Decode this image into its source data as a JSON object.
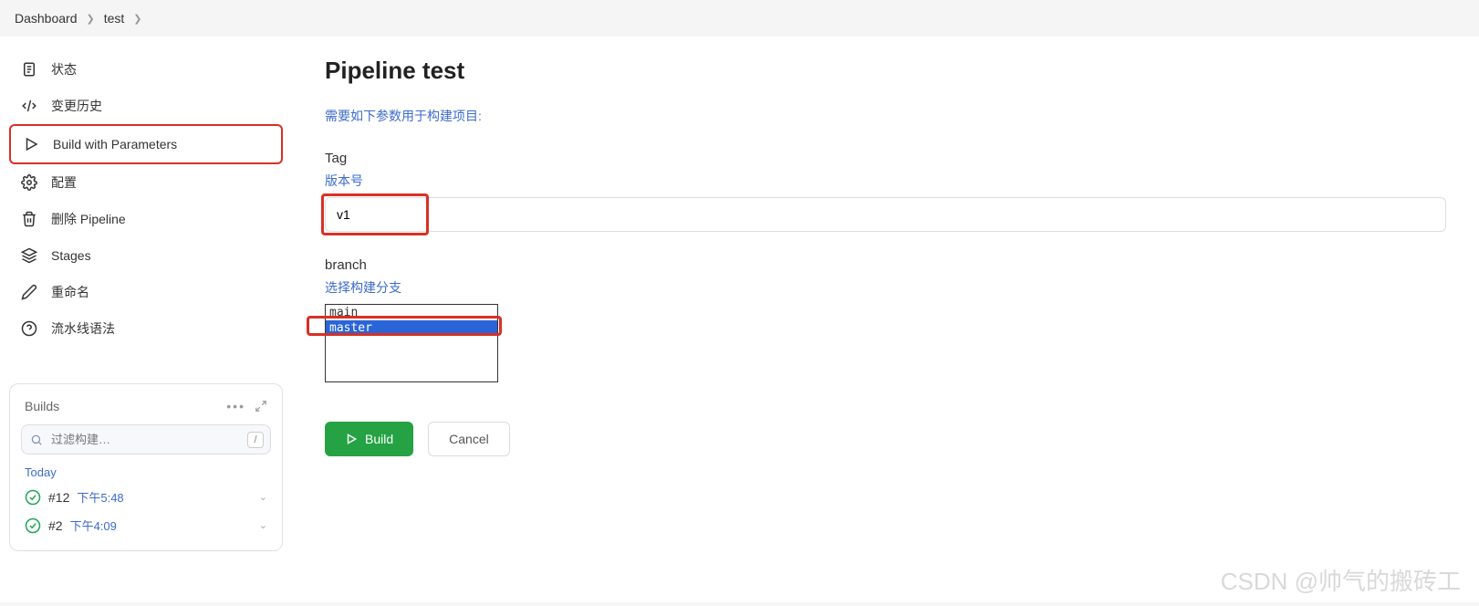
{
  "breadcrumb": {
    "dashboard": "Dashboard",
    "project": "test"
  },
  "sidebar": {
    "items": [
      {
        "label": "状态"
      },
      {
        "label": "变更历史"
      },
      {
        "label": "Build with Parameters"
      },
      {
        "label": "配置"
      },
      {
        "label": "删除 Pipeline"
      },
      {
        "label": "Stages"
      },
      {
        "label": "重命名"
      },
      {
        "label": "流水线语法"
      }
    ]
  },
  "builds": {
    "title": "Builds",
    "filter_placeholder": "过滤构建…",
    "today": "Today",
    "rows": [
      {
        "num": "#12",
        "time": "下午5:48"
      },
      {
        "num": "#2",
        "time": "下午4:09"
      }
    ]
  },
  "main": {
    "title": "Pipeline test",
    "hint": "需要如下参数用于构建项目:",
    "tag_label": "Tag",
    "tag_desc": "版本号",
    "tag_value": "v1",
    "branch_label": "branch",
    "branch_desc": "选择构建分支",
    "branch_options": {
      "main": "main",
      "master": "master"
    },
    "build_label": "Build",
    "cancel_label": "Cancel"
  },
  "watermark": "CSDN @帅气的搬砖工"
}
